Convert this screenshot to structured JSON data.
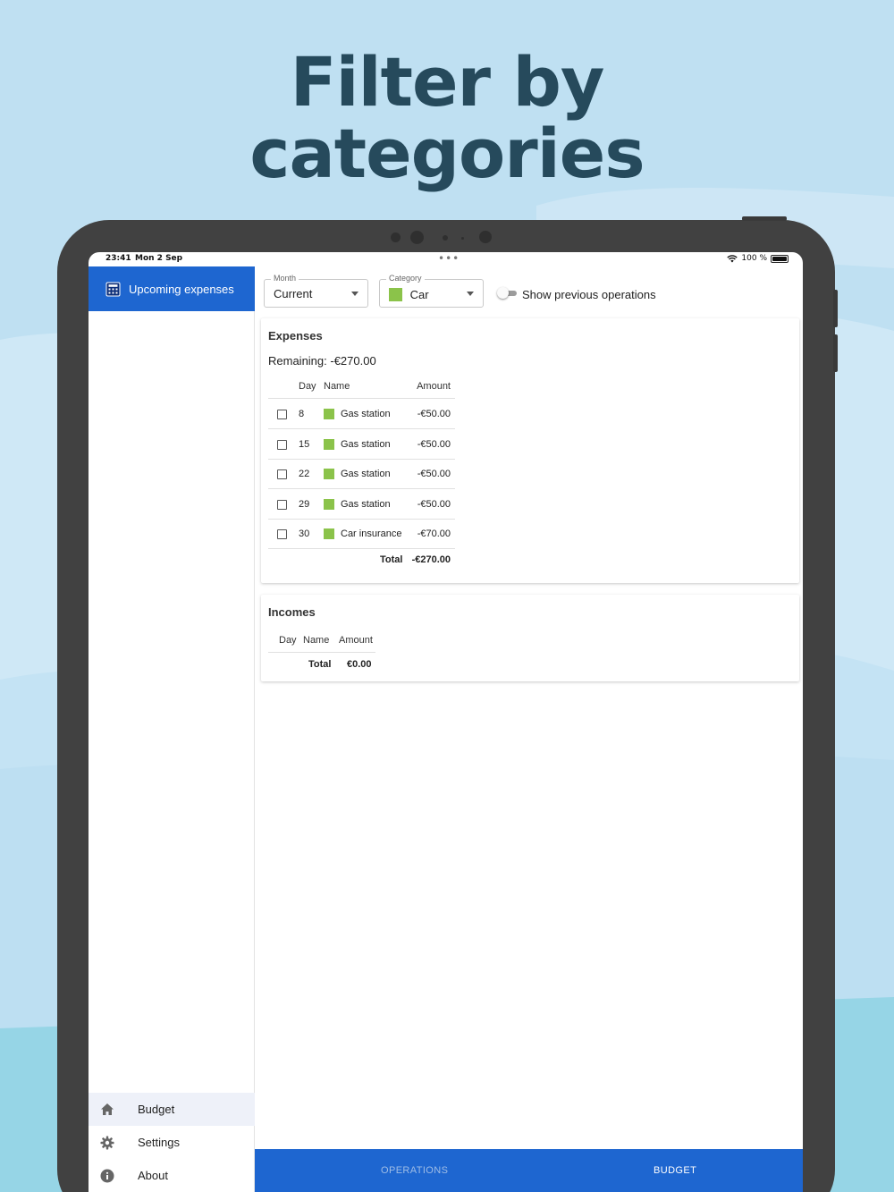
{
  "headline": {
    "line1": "Filter by",
    "line2": "categories"
  },
  "status_bar": {
    "time": "23:41",
    "date": "Mon 2 Sep",
    "battery": "100 %",
    "dots": "•••"
  },
  "sidebar": {
    "active_item": {
      "label": "Upcoming expenses",
      "icon": "calculator-icon"
    },
    "bottom_items": [
      {
        "label": "Budget",
        "icon": "home-icon",
        "selected": true
      },
      {
        "label": "Settings",
        "icon": "gear-icon",
        "selected": false
      },
      {
        "label": "About",
        "icon": "info-icon",
        "selected": false
      }
    ]
  },
  "filters": {
    "month": {
      "legend": "Month",
      "value": "Current"
    },
    "category": {
      "legend": "Category",
      "value": "Car",
      "color": "#8bc34a"
    },
    "show_previous": {
      "label": "Show previous operations",
      "on": false
    }
  },
  "expenses": {
    "title": "Expenses",
    "remaining": "Remaining: -€270.00",
    "headers": {
      "day": "Day",
      "name": "Name",
      "amount": "Amount"
    },
    "rows": [
      {
        "day": "8",
        "name": "Gas station",
        "amount": "-€50.00"
      },
      {
        "day": "15",
        "name": "Gas station",
        "amount": "-€50.00"
      },
      {
        "day": "22",
        "name": "Gas station",
        "amount": "-€50.00"
      },
      {
        "day": "29",
        "name": "Gas station",
        "amount": "-€50.00"
      },
      {
        "day": "30",
        "name": "Car insurance",
        "amount": "-€70.00"
      }
    ],
    "total_label": "Total",
    "total_value": "-€270.00"
  },
  "incomes": {
    "title": "Incomes",
    "headers": {
      "day": "Day",
      "name": "Name",
      "amount": "Amount"
    },
    "total_label": "Total",
    "total_value": "€0.00"
  },
  "bottom_nav": {
    "tabs": [
      {
        "label": "OPERATIONS",
        "active": false
      },
      {
        "label": "BUDGET",
        "active": true
      }
    ]
  },
  "colors": {
    "brand_blue": "#1e66d0",
    "category_green": "#8bc34a",
    "headline": "#264a5c",
    "background": "#bfe0f2"
  }
}
